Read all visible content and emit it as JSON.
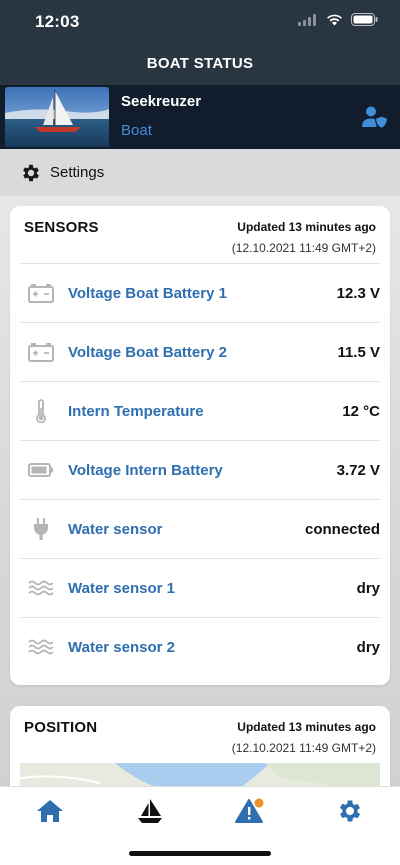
{
  "status_bar": {
    "time": "12:03"
  },
  "header": {
    "title": "BOAT STATUS"
  },
  "boat": {
    "name": "Seekreuzer",
    "type": "Boat"
  },
  "settings": {
    "label": "Settings"
  },
  "sensors": {
    "title": "SENSORS",
    "updated": "Updated 13 minutes ago",
    "timestamp": "(12.10.2021 11:49 GMT+2)",
    "rows": [
      {
        "icon": "battery-box-icon",
        "label": "Voltage Boat Battery 1",
        "value": "12.3 V"
      },
      {
        "icon": "battery-box-icon",
        "label": "Voltage Boat Battery 2",
        "value": "11.5 V"
      },
      {
        "icon": "thermometer-icon",
        "label": "Intern Temperature",
        "value": "12 °C"
      },
      {
        "icon": "battery-level-icon",
        "label": "Voltage Intern Battery",
        "value": "3.72 V"
      },
      {
        "icon": "plug-icon",
        "label": "Water sensor",
        "value": "connected"
      },
      {
        "icon": "waves-icon",
        "label": "Water sensor 1",
        "value": "dry"
      },
      {
        "icon": "waves-icon",
        "label": "Water sensor 2",
        "value": "dry"
      }
    ]
  },
  "position": {
    "title": "POSITION",
    "updated": "Updated 13 minutes ago",
    "timestamp": "(12.10.2021 11:49 GMT+2)"
  },
  "tabs": [
    {
      "name": "home",
      "icon": "home-icon"
    },
    {
      "name": "boat",
      "icon": "sailboat-icon"
    },
    {
      "name": "alerts",
      "icon": "warning-icon",
      "badge_color": "#f0902c"
    },
    {
      "name": "settings",
      "icon": "gear-icon"
    }
  ],
  "colors": {
    "accent": "#2f6fb0",
    "header": "#2a3542",
    "boat_bar": "#111d2c",
    "link": "#3f8fd8"
  }
}
